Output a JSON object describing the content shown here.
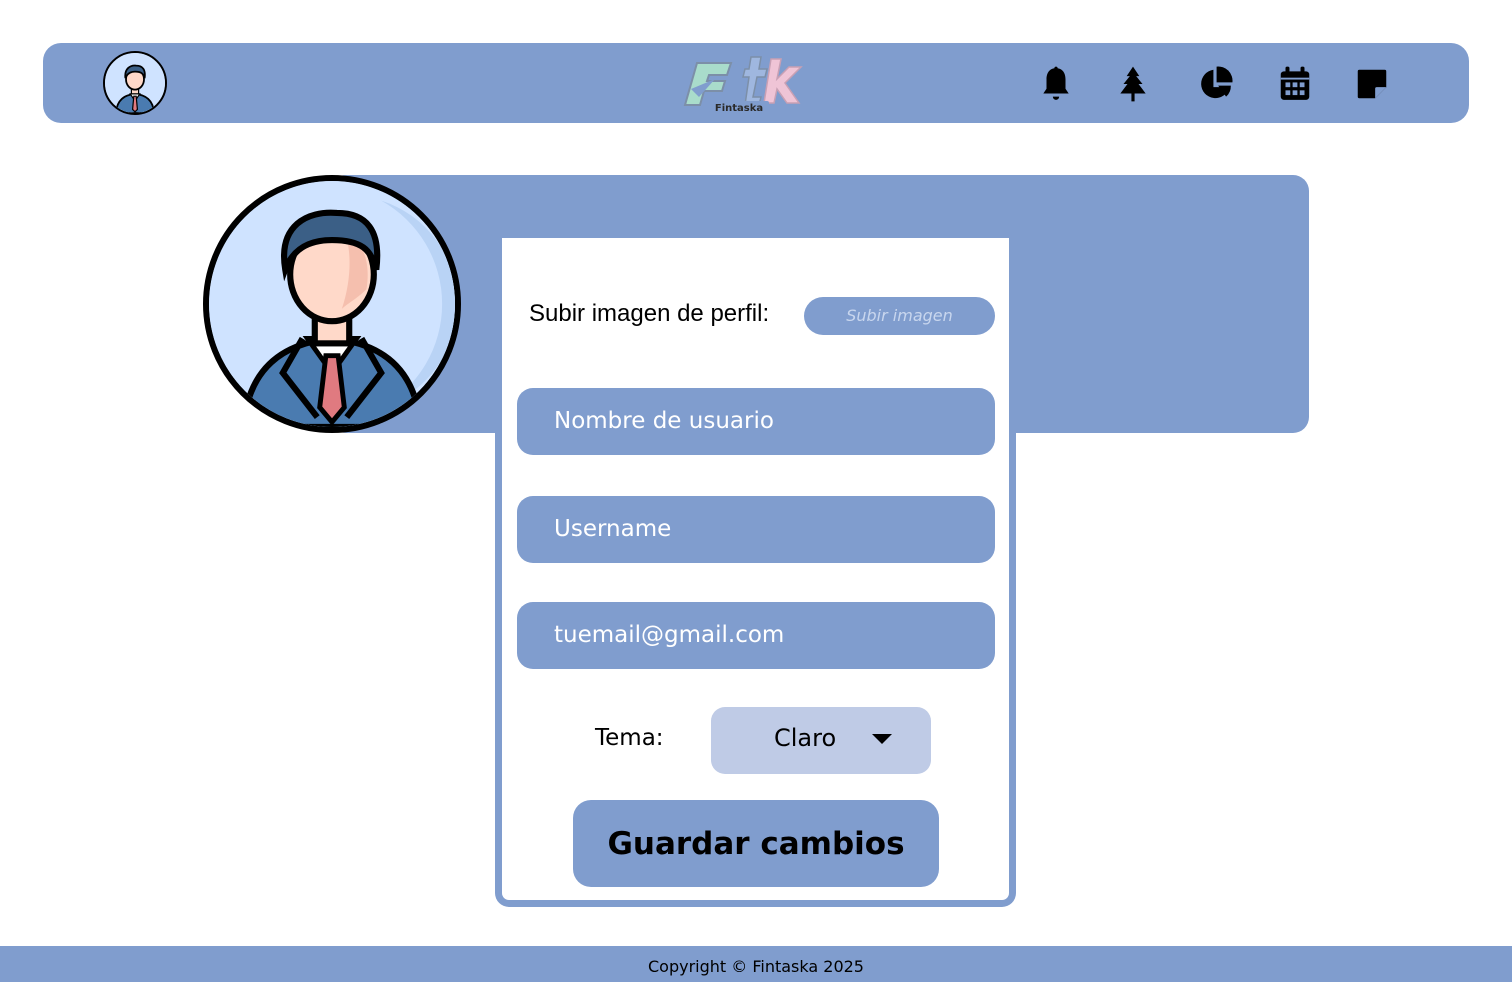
{
  "header": {
    "logo_text": "Ftk",
    "logo_subtext": "Fintaska",
    "nav_icons": [
      "bell-icon",
      "tree-icon",
      "pie-chart-icon",
      "calendar-icon",
      "sticky-note-icon"
    ]
  },
  "profile": {
    "upload_label": "Subir imagen de perfil:",
    "upload_button": "Subir imagen",
    "fields": {
      "name_placeholder": "Nombre de usuario",
      "username_placeholder": "Username",
      "email_placeholder": "tuemail@gmail.com"
    },
    "theme": {
      "label": "Tema:",
      "selected": "Claro"
    },
    "save_button": "Guardar cambios"
  },
  "footer": {
    "copyright": "Copyright © Fintaska 2025"
  },
  "colors": {
    "primary": "#809dce",
    "select_bg": "#bfcbe6",
    "background": "#ffffff"
  }
}
